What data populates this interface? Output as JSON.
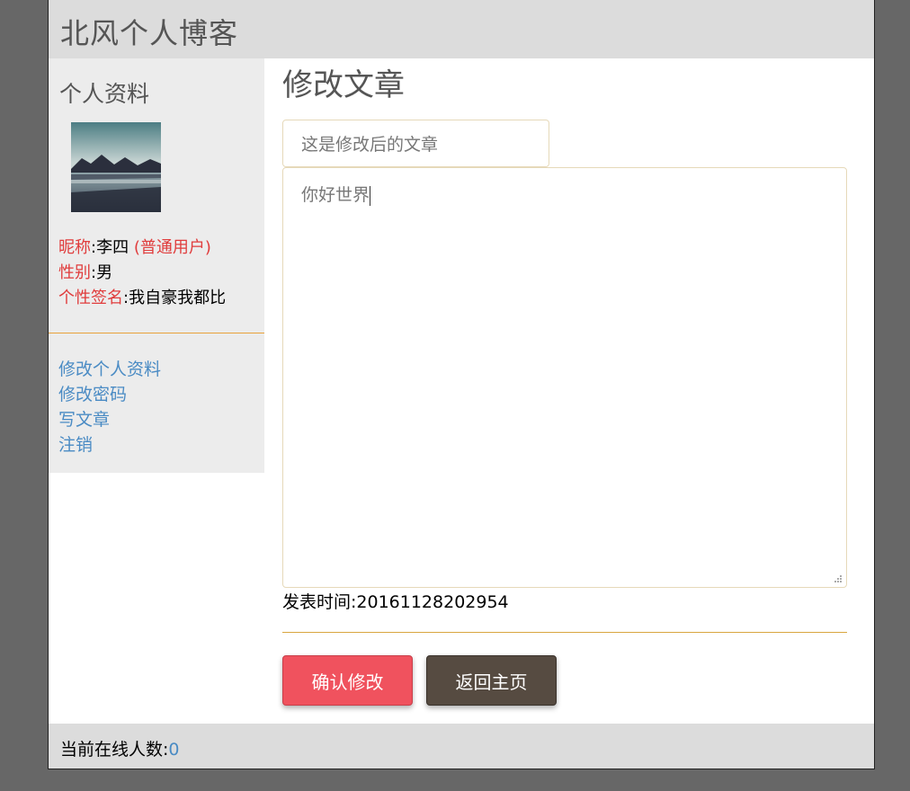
{
  "header": {
    "title": "北风个人博客"
  },
  "sidebar": {
    "heading": "个人资料",
    "avatar_alt": "lake-mountain-avatar",
    "profile": {
      "nickname_label": "昵称",
      "nickname_value": "李四",
      "role": "(普通用户)",
      "gender_label": "性别",
      "gender_value": "男",
      "signature_label": "个性签名",
      "signature_value": "我自豪我都比"
    },
    "links": [
      {
        "label": "修改个人资料"
      },
      {
        "label": "修改密码"
      },
      {
        "label": "写文章"
      },
      {
        "label": "注销"
      }
    ]
  },
  "main": {
    "heading": "修改文章",
    "title_value": "这是修改后的文章",
    "content_value": "你好世界",
    "publish_label": "发表时间:",
    "publish_time": "20161128202954",
    "confirm_label": "确认修改",
    "home_label": "返回主页"
  },
  "footer": {
    "online_label": "当前在线人数:",
    "online_count": "0"
  },
  "colors": {
    "accent_red": "#e03c3c",
    "link_blue": "#4a8bc4",
    "confirm_button": "#f0525e",
    "home_button": "#564b41",
    "divider": "#e9a23b"
  }
}
